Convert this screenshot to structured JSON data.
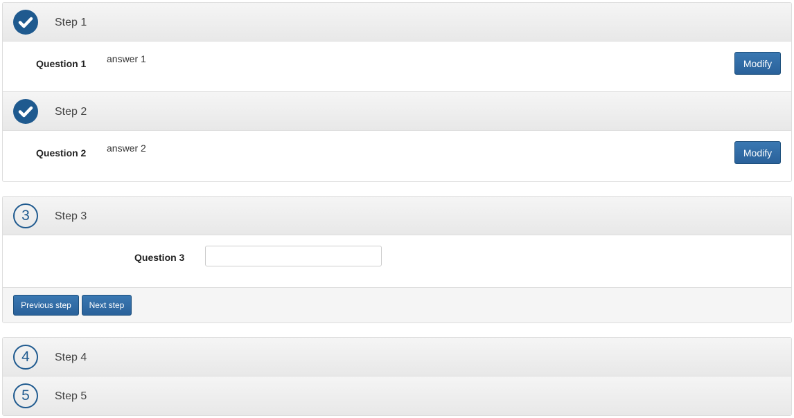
{
  "steps": [
    {
      "number": "1",
      "title": "Step 1",
      "status": "done",
      "question": "Question 1",
      "answer": "answer 1",
      "modify_label": "Modify"
    },
    {
      "number": "2",
      "title": "Step 2",
      "status": "done",
      "question": "Question 2",
      "answer": "answer 2",
      "modify_label": "Modify"
    },
    {
      "number": "3",
      "title": "Step 3",
      "status": "current",
      "question": "Question 3",
      "input_value": "",
      "input_placeholder": ""
    },
    {
      "number": "4",
      "title": "Step 4",
      "status": "pending"
    },
    {
      "number": "5",
      "title": "Step 5",
      "status": "pending"
    }
  ],
  "footer": {
    "previous_label": "Previous step",
    "next_label": "Next step"
  },
  "colors": {
    "accent": "#1f5a8f",
    "button": "#2b6aa3",
    "header_bg": "#eeeeee",
    "border": "#dddddd"
  },
  "icons": {
    "done": "check-icon"
  }
}
